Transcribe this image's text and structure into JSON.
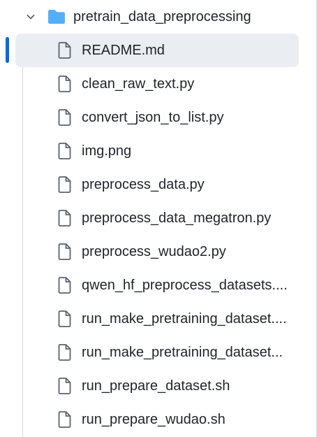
{
  "folder": {
    "name": "pretrain_data_preprocessing",
    "expanded": true,
    "icon": "folder-icon",
    "chevron_icon": "chevron-down-icon",
    "icon_color": "#54aeff"
  },
  "accent_color": "#0969da",
  "selected_index": 0,
  "files": [
    {
      "name": "README.md",
      "icon": "file-icon"
    },
    {
      "name": "clean_raw_text.py",
      "icon": "file-icon"
    },
    {
      "name": "convert_json_to_list.py",
      "icon": "file-icon"
    },
    {
      "name": "img.png",
      "icon": "file-icon"
    },
    {
      "name": "preprocess_data.py",
      "icon": "file-icon"
    },
    {
      "name": "preprocess_data_megatron.py",
      "icon": "file-icon"
    },
    {
      "name": "preprocess_wudao2.py",
      "icon": "file-icon"
    },
    {
      "name": "qwen_hf_preprocess_datasets....",
      "icon": "file-icon"
    },
    {
      "name": "run_make_pretraining_dataset....",
      "icon": "file-icon"
    },
    {
      "name": "run_make_pretraining_dataset...",
      "icon": "file-icon"
    },
    {
      "name": "run_prepare_dataset.sh",
      "icon": "file-icon"
    },
    {
      "name": "run_prepare_wudao.sh",
      "icon": "file-icon"
    }
  ]
}
